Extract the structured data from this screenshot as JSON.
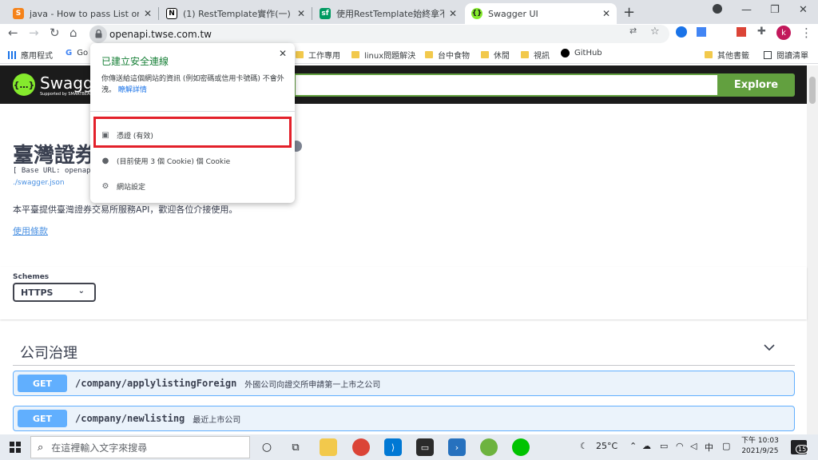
{
  "browser": {
    "tabs": [
      {
        "title": "java - How to pass List or String"
      },
      {
        "title": "(1) RestTemplate實作(一)"
      },
      {
        "title": "使用RestTemplate始終拿不到預"
      },
      {
        "title": "Swagger UI"
      }
    ],
    "url": "openapi.twse.com.tw",
    "bookmarks": [
      "應用程式",
      "Go",
      "工作專用",
      "linux問題解決",
      "台中食物",
      "休閒",
      "視訊",
      "GitHub",
      "其他書籤",
      "閱讀清單"
    ],
    "profile_initial": "k"
  },
  "swagger": {
    "brand": "Swagger",
    "brand_sub": "Supported by SMARTBEAR",
    "explore_label": "Explore",
    "title": "臺灣證券",
    "base_url": "[ Base URL: openapi",
    "spec_link": "./swagger.json",
    "description": "本平臺提供臺灣證券交易所服務API，歡迎各位介接使用。",
    "terms_link": "使用條款",
    "schemes_label": "Schemes",
    "scheme_selected": "HTTPS",
    "tag_name": "公司治理",
    "operations": [
      {
        "method": "GET",
        "path": "/company/applylistingForeign",
        "summary": "外國公司向證交所申請第一上市之公司"
      },
      {
        "method": "GET",
        "path": "/company/newlisting",
        "summary": "最近上市公司"
      }
    ]
  },
  "site_info_popup": {
    "title": "已建立安全連線",
    "description": "你傳送給這個網站的資訊 (例如密碼或信用卡號碼) 不會外洩。",
    "learn_more": "瞭解詳情",
    "items": [
      "憑證 (有效)",
      "(目前使用 3 個 Cookie) 個 Cookie",
      "網站設定"
    ]
  },
  "taskbar": {
    "search_placeholder": "在這裡輸入文字來搜尋",
    "temperature": "25°C",
    "ime": "中",
    "time": "下午 10:03",
    "date": "2021/9/25",
    "notifications": "15"
  },
  "colors": {
    "swagger_header": "#1b1b1b",
    "swagger_green": "#62a03f",
    "get_blue": "#61affe",
    "highlight_red": "#e3202a",
    "secure_green": "#188038"
  }
}
